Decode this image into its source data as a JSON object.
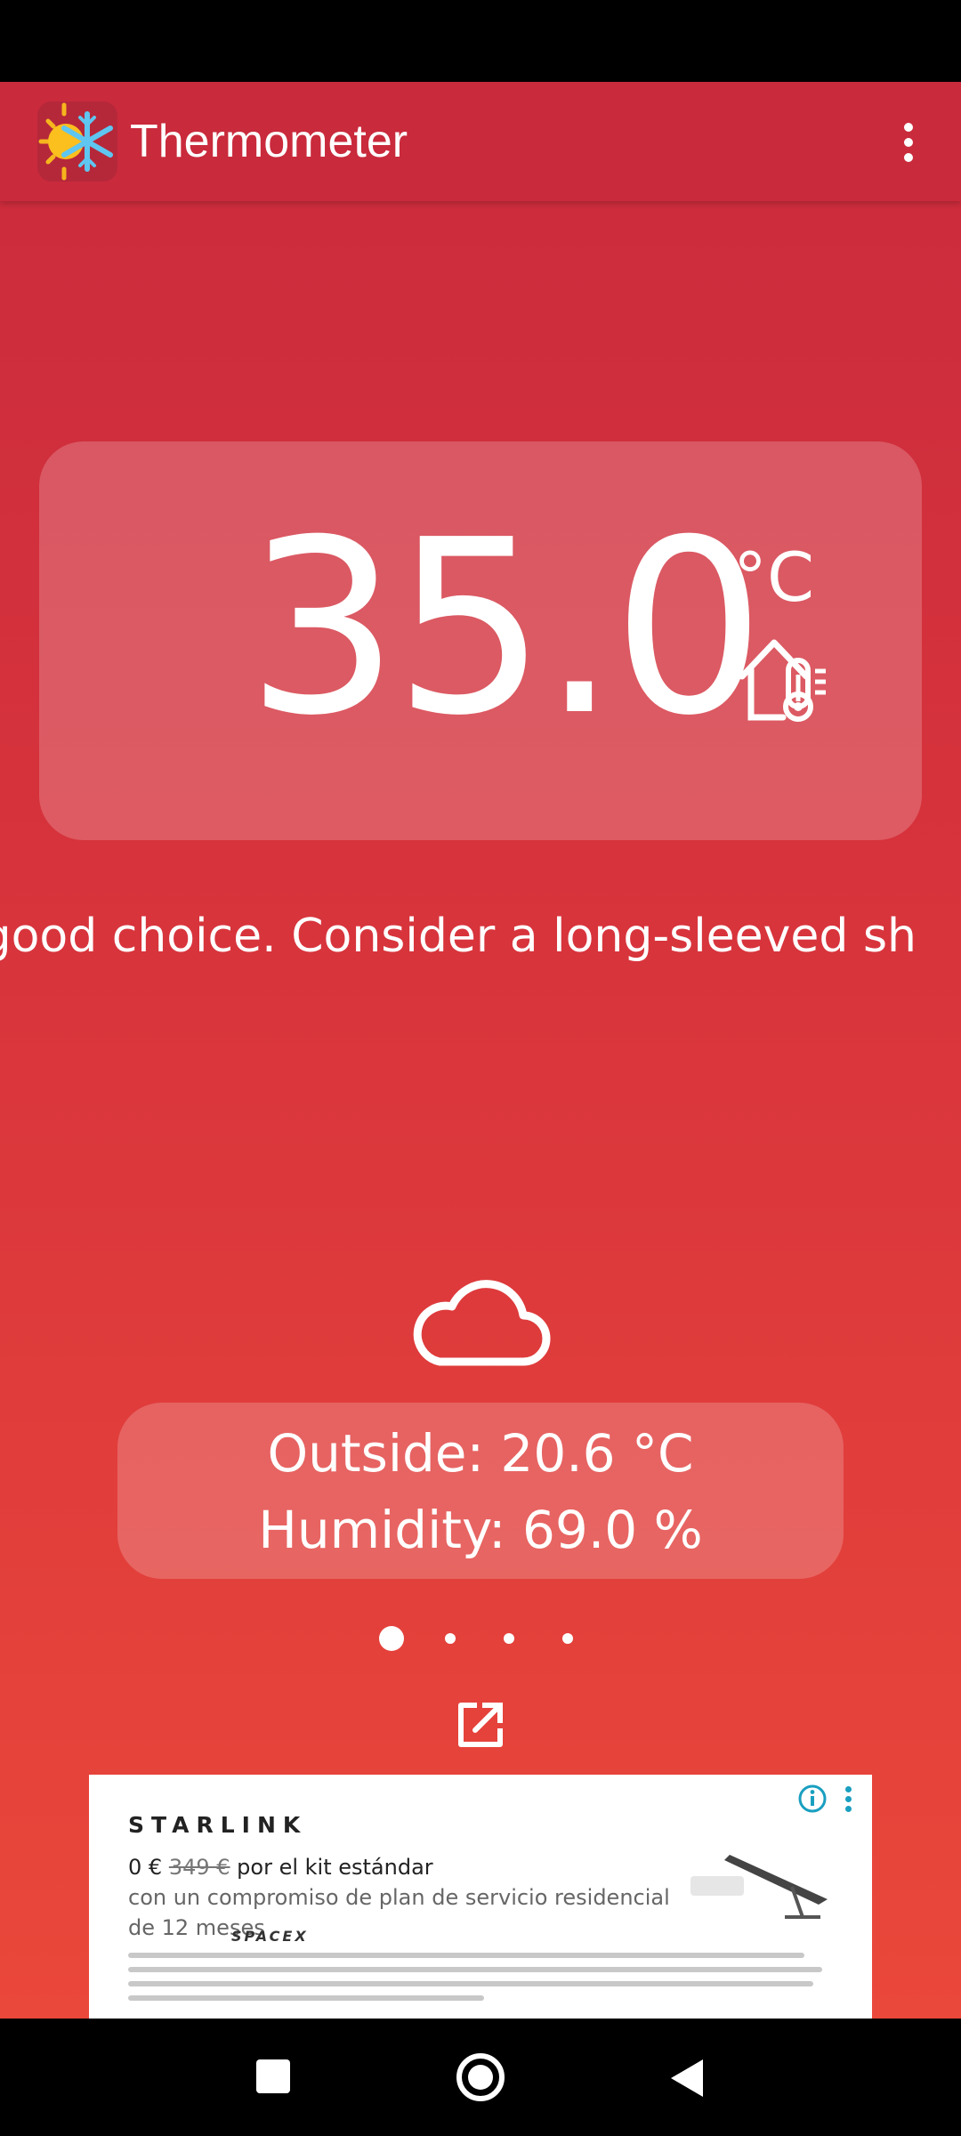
{
  "app": {
    "title": "Thermometer",
    "logo_icon": "sun-snowflake-icon",
    "menu_icon": "more-vertical-icon"
  },
  "indoor": {
    "temperature": "35.0",
    "unit": "°C",
    "icon": "house-thermometer-icon"
  },
  "advice": {
    "text": "good choice. Consider a long-sleeved sh"
  },
  "outside": {
    "weather_icon": "cloud-icon",
    "temperature_line": "Outside: 20.6 °C",
    "humidity_line": "Humidity: 69.0 %"
  },
  "pager": {
    "page_count": 4,
    "active_index": 0
  },
  "open_icon": "open-in-new-icon",
  "ad": {
    "brand": "STARLINK",
    "price_new": "0 €",
    "price_old": "349 €",
    "price_suffix": "por el kit estándar",
    "line2": "con un compromiso de plan de servicio residencial",
    "line3": "de 12 meses",
    "spacex": "SPACEX",
    "info_icon": "info-icon",
    "more_icon": "more-vertical-icon"
  },
  "colors": {
    "background_top": "#c92a3c",
    "background_bottom": "#ec4a3a",
    "ad_accent": "#1a9fc0"
  },
  "nav": {
    "recent_icon": "recent-apps-icon",
    "home_icon": "home-icon",
    "back_icon": "back-icon"
  }
}
